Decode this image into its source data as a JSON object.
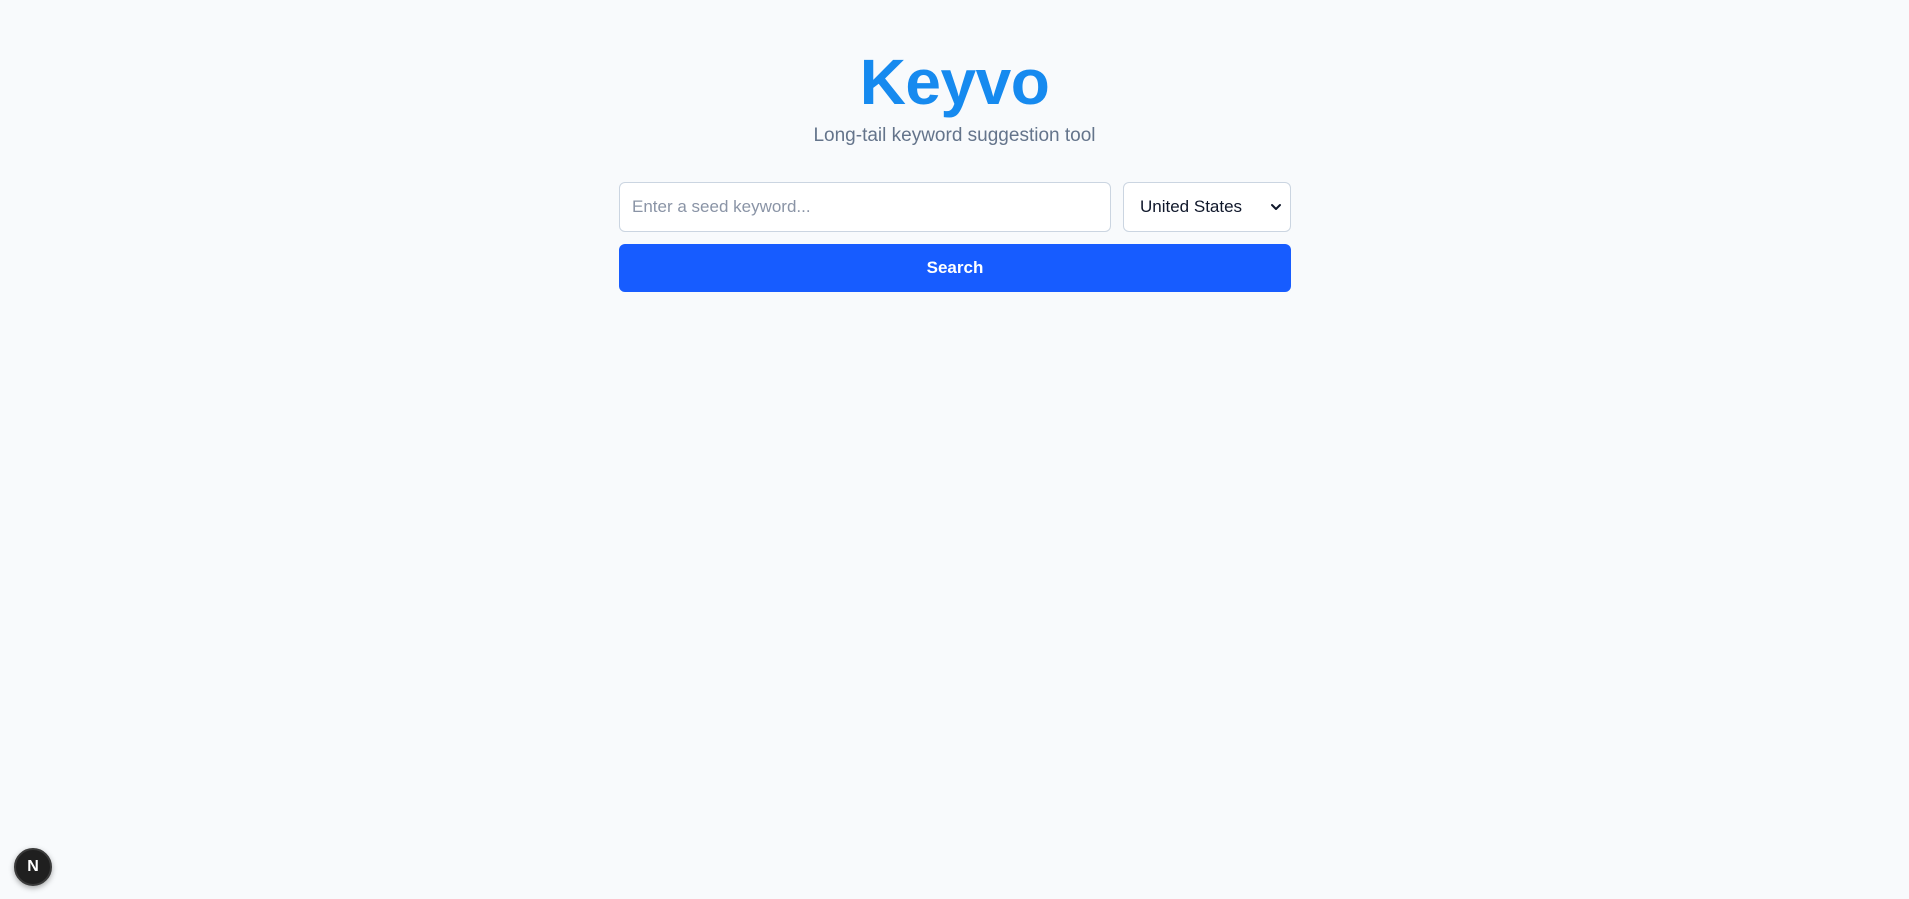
{
  "header": {
    "title": "Keyvo",
    "tagline": "Long-tail keyword suggestion tool"
  },
  "search": {
    "placeholder": "Enter a seed keyword...",
    "value": "",
    "country_selected": "United States",
    "button_label": "Search"
  },
  "dev_badge": {
    "label": "N"
  },
  "colors": {
    "brand": "#168aef",
    "primary_button": "#175cff",
    "background": "#f8fafc",
    "muted_text": "#64748b"
  },
  "icons": {
    "select_chevron": "chevron-down-icon"
  }
}
